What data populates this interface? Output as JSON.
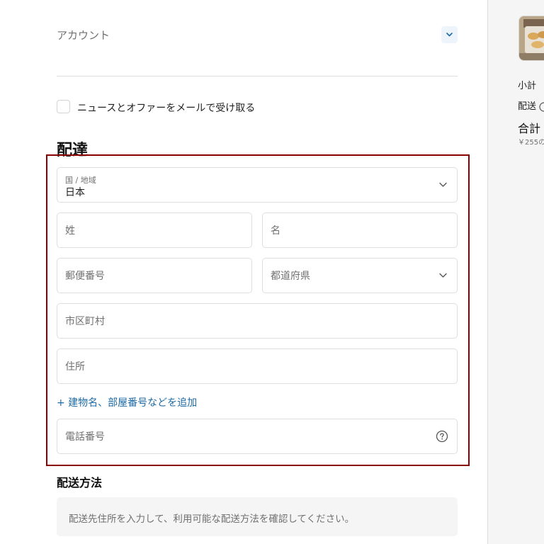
{
  "account": {
    "label": "アカウント"
  },
  "newsletter": {
    "label": "ニュースとオファーをメールで受け取る",
    "checked": false
  },
  "delivery": {
    "title": "配達",
    "country": {
      "small_label": "国 / 地域",
      "value": "日本"
    },
    "last_name": {
      "placeholder": "姓"
    },
    "first_name": {
      "placeholder": "名"
    },
    "postal_code": {
      "placeholder": "郵便番号"
    },
    "prefecture": {
      "placeholder": "都道府県"
    },
    "city": {
      "placeholder": "市区町村"
    },
    "address": {
      "placeholder": "住所"
    },
    "add_address_line": "+ 建物名、部屋番号などを追加",
    "phone": {
      "placeholder": "電話番号"
    }
  },
  "shipping_method": {
    "title": "配送方法",
    "notice": "配送先住所を入力して、利用可能な配送方法を確認してください。"
  },
  "summary": {
    "subtotal_label": "小計",
    "shipping_label": "配送",
    "total_label": "合計",
    "tax_note": "￥255の"
  },
  "colors": {
    "accent_link": "#1c6aa6",
    "highlight_border": "#8b0000",
    "field_border": "#dedede",
    "muted_text": "#707070"
  },
  "icons": {
    "account_toggle": "chevron-down-icon",
    "select_arrow": "chevron-down-icon",
    "phone_help": "question-circle-icon",
    "shipping_info": "info-circle-icon"
  }
}
